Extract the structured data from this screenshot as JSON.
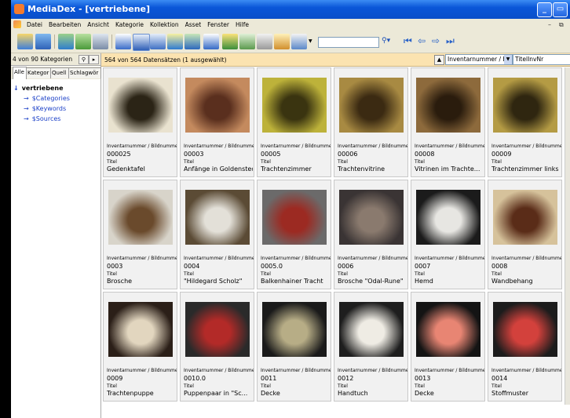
{
  "window": {
    "title": "MediaDex - [vertriebene]"
  },
  "menu": [
    "Datei",
    "Bearbeiten",
    "Ansicht",
    "Kategorie",
    "Kollektion",
    "Asset",
    "Fenster",
    "Hilfe"
  ],
  "left_panel": {
    "count_text": "4 von 90 Kategorien",
    "tabs": [
      "Alle",
      "Kategor",
      "Quell",
      "Schlagwör"
    ],
    "tree": {
      "root": "vertriebene",
      "children": [
        "$Categories",
        "$Keywords",
        "$Sources"
      ]
    }
  },
  "right_panel": {
    "status_text": "564 von 564 Datensätzen (1 ausgewählt)",
    "sort_field_select": "Inventarnummer / Bi",
    "sort_field_name": "TitelInvNr"
  },
  "records": [
    {
      "label1": "Inventarnummer / Bildnummer",
      "inv": "000025",
      "label2": "Titel",
      "title": "Gedenktafel",
      "colors": [
        "#e9e2cf",
        "#2b2416"
      ]
    },
    {
      "label1": "Inventarnummer / Bildnummer",
      "inv": "00003",
      "label2": "Titel",
      "title": "Anfänge in Goldenstedt",
      "colors": [
        "#c48a5e",
        "#5a2f1e"
      ]
    },
    {
      "label1": "Inventarnummer / Bildnummer",
      "inv": "00005",
      "label2": "Titel",
      "title": "Trachtenzimmer",
      "colors": [
        "#bdb23a",
        "#3a3410"
      ]
    },
    {
      "label1": "Inventarnummer / Bildnummer",
      "inv": "00006",
      "label2": "Titel",
      "title": "Trachtenvitrine",
      "colors": [
        "#a88a42",
        "#3b2a12"
      ]
    },
    {
      "label1": "Inventarnummer / Bildnummer",
      "inv": "00008",
      "label2": "Titel",
      "title": "Vitrinen im Trachte...",
      "colors": [
        "#8d6a3c",
        "#2a1c0d"
      ]
    },
    {
      "label1": "Inventarnummer / Bildnummer",
      "inv": "00009",
      "label2": "Titel",
      "title": "Trachtenzimmer links",
      "colors": [
        "#b49b44",
        "#2f2610"
      ]
    },
    {
      "label1": "Inventarnummer / Bildnummer",
      "inv": "0003",
      "label2": "Titel",
      "title": "Brosche",
      "colors": [
        "#d8d4ca",
        "#6a4a2c"
      ]
    },
    {
      "label1": "Inventarnummer / Bildnummer",
      "inv": "0004",
      "label2": "Titel",
      "title": "\"Hildegard Scholz\"",
      "colors": [
        "#5b4b35",
        "#e3e0d8"
      ]
    },
    {
      "label1": "Inventarnummer / Bildnummer",
      "inv": "0005.0",
      "label2": "Titel",
      "title": "Balkenhainer Tracht",
      "colors": [
        "#6b6a6a",
        "#9c2a22"
      ]
    },
    {
      "label1": "Inventarnummer / Bildnummer",
      "inv": "0006",
      "label2": "Titel",
      "title": "Brosche \"Odal-Rune\"",
      "colors": [
        "#3a3434",
        "#8a7a6e"
      ]
    },
    {
      "label1": "Inventarnummer / Bildnummer",
      "inv": "0007",
      "label2": "Titel",
      "title": "Hemd",
      "colors": [
        "#1b1b1b",
        "#e7e6e2"
      ]
    },
    {
      "label1": "Inventarnummer / Bildnummer",
      "inv": "0008",
      "label2": "Titel",
      "title": "Wandbehang",
      "colors": [
        "#d6c29b",
        "#5a2c18"
      ]
    },
    {
      "label1": "Inventarnummer / Bildnummer",
      "inv": "0009",
      "label2": "Titel",
      "title": "Trachtenpuppe",
      "colors": [
        "#2b1f18",
        "#e2d6bf"
      ]
    },
    {
      "label1": "Inventarnummer / Bildnummer",
      "inv": "0010.0",
      "label2": "Titel",
      "title": "Puppenpaar in  \"Sc...",
      "colors": [
        "#2a2a2a",
        "#b32a28"
      ]
    },
    {
      "label1": "Inventarnummer / Bildnummer",
      "inv": "0011",
      "label2": "Titel",
      "title": "Decke",
      "colors": [
        "#1a1a1a",
        "#b7ad86"
      ]
    },
    {
      "label1": "Inventarnummer / Bildnummer",
      "inv": "0012",
      "label2": "Titel",
      "title": "Handtuch",
      "colors": [
        "#1e1e1e",
        "#efece4"
      ]
    },
    {
      "label1": "Inventarnummer / Bildnummer",
      "inv": "0013",
      "label2": "Titel",
      "title": "Decke",
      "colors": [
        "#141414",
        "#e88573"
      ]
    },
    {
      "label1": "Inventarnummer / Bildnummer",
      "inv": "0014",
      "label2": "Titel",
      "title": "Stoffmuster",
      "colors": [
        "#1c1c1c",
        "#d3413c"
      ]
    }
  ]
}
